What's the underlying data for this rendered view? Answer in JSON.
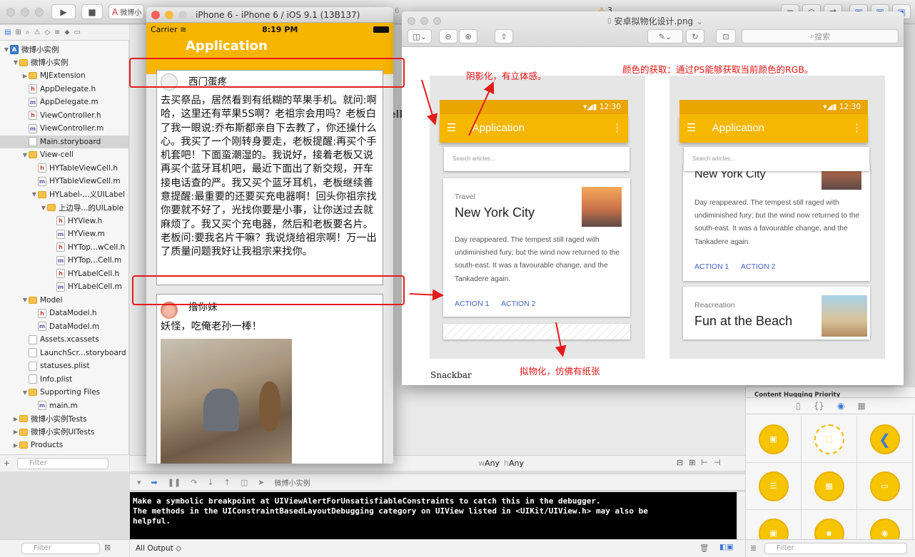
{
  "xcode": {
    "scheme_tab": "微博小",
    "tab_overlap": "6",
    "warning_count": "3",
    "nav_filter_placeholder": "Filter",
    "console_filter_placeholder": "Filter",
    "size_class_w": "Any",
    "size_class_h": "Any",
    "debug_target": "微博小实例",
    "console_output_select": "All Output ◇",
    "console_lines": [
      "Make a symbolic breakpoint at UIViewAlertForUnsatisfiableConstraints to catch this in the debugger.",
      "The methods in the UIConstraintBasedLayoutDebugging category on UIView listed in <UIKit/UIView.h> may also be",
      "helpful."
    ],
    "library_filter_placeholder": "Filter",
    "inspector_label": "Content Hugging Priority",
    "editor_peek": "ell"
  },
  "navigator": {
    "items": [
      {
        "label": "微博小实例",
        "type": "proj",
        "indent": 0,
        "disclosure": "▼"
      },
      {
        "label": "微博小实例",
        "type": "folder",
        "indent": 1,
        "disclosure": "▼"
      },
      {
        "label": "MJExtension",
        "type": "folder",
        "indent": 2,
        "disclosure": "▶"
      },
      {
        "label": "AppDelegate.h",
        "type": "h",
        "indent": 2,
        "disclosure": ""
      },
      {
        "label": "AppDelegate.m",
        "type": "m",
        "indent": 2,
        "disclosure": ""
      },
      {
        "label": "ViewController.h",
        "type": "h",
        "indent": 2,
        "disclosure": ""
      },
      {
        "label": "ViewController.m",
        "type": "m",
        "indent": 2,
        "disclosure": ""
      },
      {
        "label": "Main.storyboard",
        "type": "other",
        "indent": 2,
        "disclosure": "",
        "selected": true
      },
      {
        "label": "View-cell",
        "type": "folder",
        "indent": 2,
        "disclosure": "▼"
      },
      {
        "label": "HYTableViewCell.h",
        "type": "h",
        "indent": 3,
        "disclosure": ""
      },
      {
        "label": "HYTableViewCell.m",
        "type": "m",
        "indent": 3,
        "disclosure": ""
      },
      {
        "label": "HYLabel-...义UILabel",
        "type": "folder",
        "indent": 3,
        "disclosure": "▼"
      },
      {
        "label": "上边导...的UILable",
        "type": "folder",
        "indent": 4,
        "disclosure": "▼"
      },
      {
        "label": "HYView.h",
        "type": "h",
        "indent": 5,
        "disclosure": ""
      },
      {
        "label": "HYView.m",
        "type": "m",
        "indent": 5,
        "disclosure": ""
      },
      {
        "label": "HYTop...wCell.h",
        "type": "h",
        "indent": 5,
        "disclosure": ""
      },
      {
        "label": "HYTop...Cell.m",
        "type": "m",
        "indent": 5,
        "disclosure": ""
      },
      {
        "label": "HYLabelCell.h",
        "type": "h",
        "indent": 5,
        "disclosure": ""
      },
      {
        "label": "HYLabelCell.m",
        "type": "m",
        "indent": 5,
        "disclosure": ""
      },
      {
        "label": "Model",
        "type": "folder",
        "indent": 2,
        "disclosure": "▼"
      },
      {
        "label": "DataModel.h",
        "type": "h",
        "indent": 3,
        "disclosure": ""
      },
      {
        "label": "DataModel.m",
        "type": "m",
        "indent": 3,
        "disclosure": ""
      },
      {
        "label": "Assets.xcassets",
        "type": "other",
        "indent": 2,
        "disclosure": ""
      },
      {
        "label": "LaunchScr...storyboard",
        "type": "other",
        "indent": 2,
        "disclosure": ""
      },
      {
        "label": "statuses.plist",
        "type": "other",
        "indent": 2,
        "disclosure": ""
      },
      {
        "label": "Info.plist",
        "type": "other",
        "indent": 2,
        "disclosure": ""
      },
      {
        "label": "Supporting Files",
        "type": "folder",
        "indent": 2,
        "disclosure": "▼"
      },
      {
        "label": "main.m",
        "type": "m",
        "indent": 3,
        "disclosure": ""
      },
      {
        "label": "微博小实例Tests",
        "type": "folder",
        "indent": 1,
        "disclosure": "▶"
      },
      {
        "label": "微博小实例UITests",
        "type": "folder",
        "indent": 1,
        "disclosure": "▶"
      },
      {
        "label": "Products",
        "type": "folder",
        "indent": 1,
        "disclosure": "▶"
      }
    ]
  },
  "simulator": {
    "title": "iPhone 6 - iPhone 6 / iOS 9.1 (13B137)",
    "carrier": "Carrier",
    "time": "8:19 PM",
    "nav_title": "Application",
    "cell1": {
      "name": "西门蛋疼",
      "text": "去买祭品，居然看到有纸糊的苹果手机。就问:啊哈，这里还有苹果5S啊？老祖宗会用吗？老板白了我一眼说:乔布斯都亲自下去教了，你还操什么心。我买了一个刚转身要走，老板提醒:再买个手机套吧！下面蛮潮湿的。我说好，接着老板又说再买个蓝牙耳机吧，最近下面出了新交规，开车接电话查的严。我又买个蓝牙耳机，老板继续善意提醒:最重要的还要买充电器啊！回头你祖宗找你要就不好了，光找你要是小事，让你送过去就麻烦了。我又买个充电器，然后和老板要名片。老板问:要我名片干嘛？我说烧给祖宗啊！万一出了质量问题我好让我祖宗来找你。"
    },
    "cell2": {
      "name": "撸你妹",
      "text": "妖怪，吃俺老孙一棒！"
    }
  },
  "preview": {
    "title": "安卓拟物化设计.png",
    "search_placeholder": "搜索",
    "snackbar": "Snackbar",
    "phone_left": {
      "time": "12:30",
      "app_title": "Application",
      "search": "Search articles...",
      "card_category": "Travel",
      "card_title": "New York City",
      "card_body": "Day reappeared. The tempest still raged with undiminished fury; but the wind now returned to the south-east. It was a favourable change, and the Tankadere again.",
      "action1": "ACTION 1",
      "action2": "ACTION 2"
    },
    "phone_right": {
      "time": "12:30",
      "app_title": "Application",
      "search": "Search articles...",
      "card_title": "New York City",
      "card_body": "Day reappeared. The tempest still raged with undiminished fury; but the wind now returned to the south-east. It was a favourable change, and the Tankadere again.",
      "action1": "ACTION 1",
      "action2": "ACTION 2",
      "card2_category": "Reacreation",
      "card2_title": "Fun at the Beach"
    }
  },
  "annotations": {
    "shadow": "阴影化，有立体感。",
    "color": "颜色的获取：通过PS能够获取当前颜色的RGB。",
    "skeuo": "拟物化，仿佛有纸张"
  },
  "colors": {
    "accent_yellow": "#f7b500",
    "annotation_red": "#e31515",
    "md_action_blue": "#4563c4"
  }
}
